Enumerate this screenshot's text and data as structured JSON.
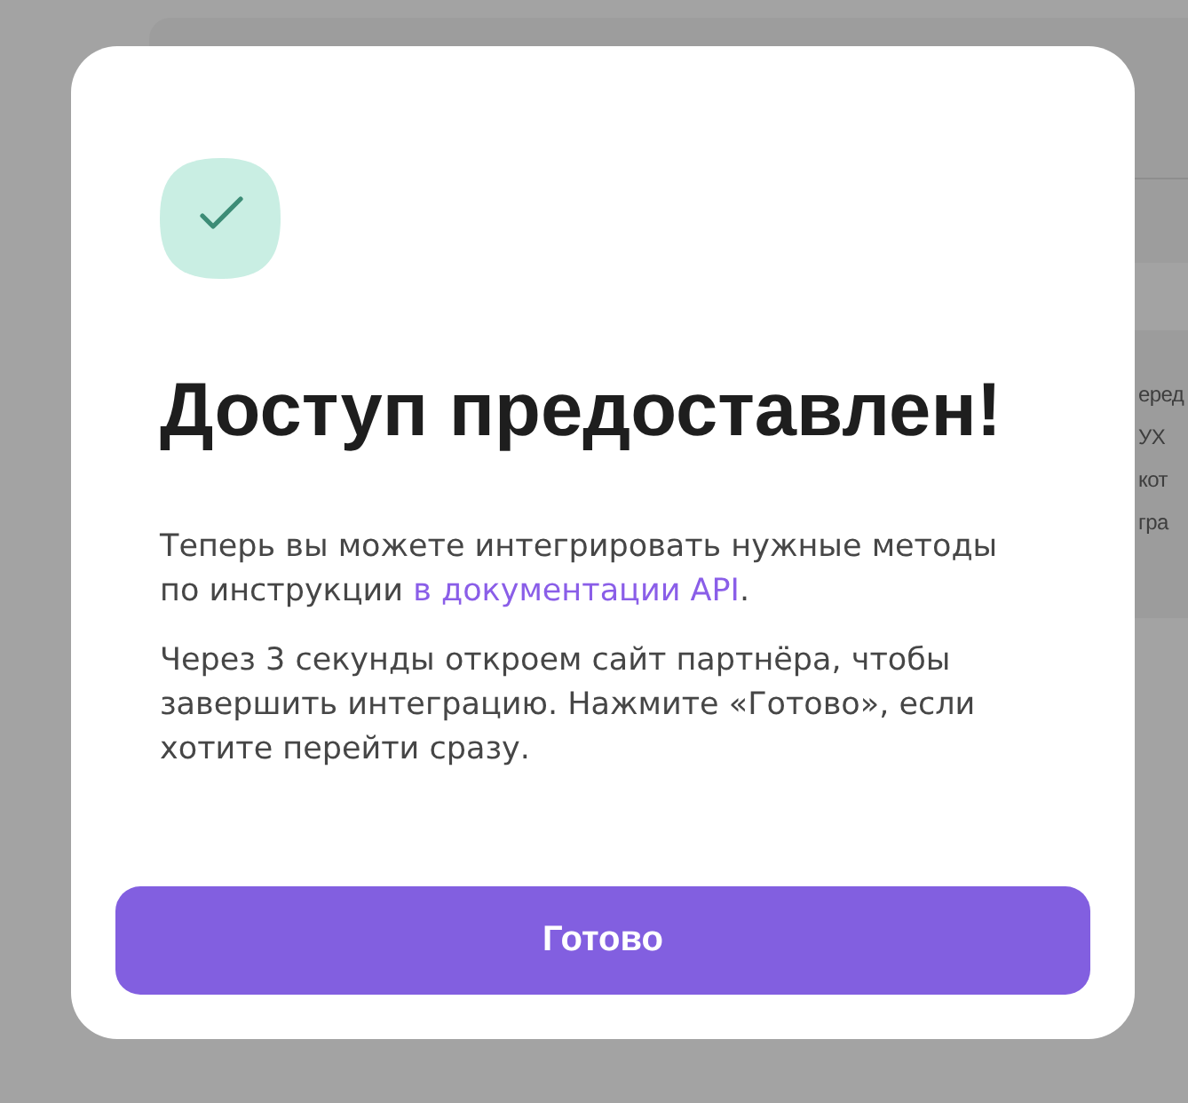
{
  "background": {
    "panel_lines": [
      "еред",
      "УХ",
      "кот",
      "гра"
    ]
  },
  "dialog": {
    "title": "Доступ предоставлен!",
    "paragraphs": [
      {
        "parts": [
          {
            "kind": "text",
            "text": "Теперь вы можете интегрировать нужные методы по инструкции "
          },
          {
            "kind": "link",
            "text": "в документации API"
          },
          {
            "kind": "text",
            "text": "."
          }
        ]
      },
      {
        "parts": [
          {
            "kind": "text",
            "text": "Через 3 секунды откроем сайт партнёра, чтобы завершить интеграцию. Нажмите «Готово», если хотите перейти сразу."
          }
        ]
      }
    ],
    "button": "Готово"
  }
}
